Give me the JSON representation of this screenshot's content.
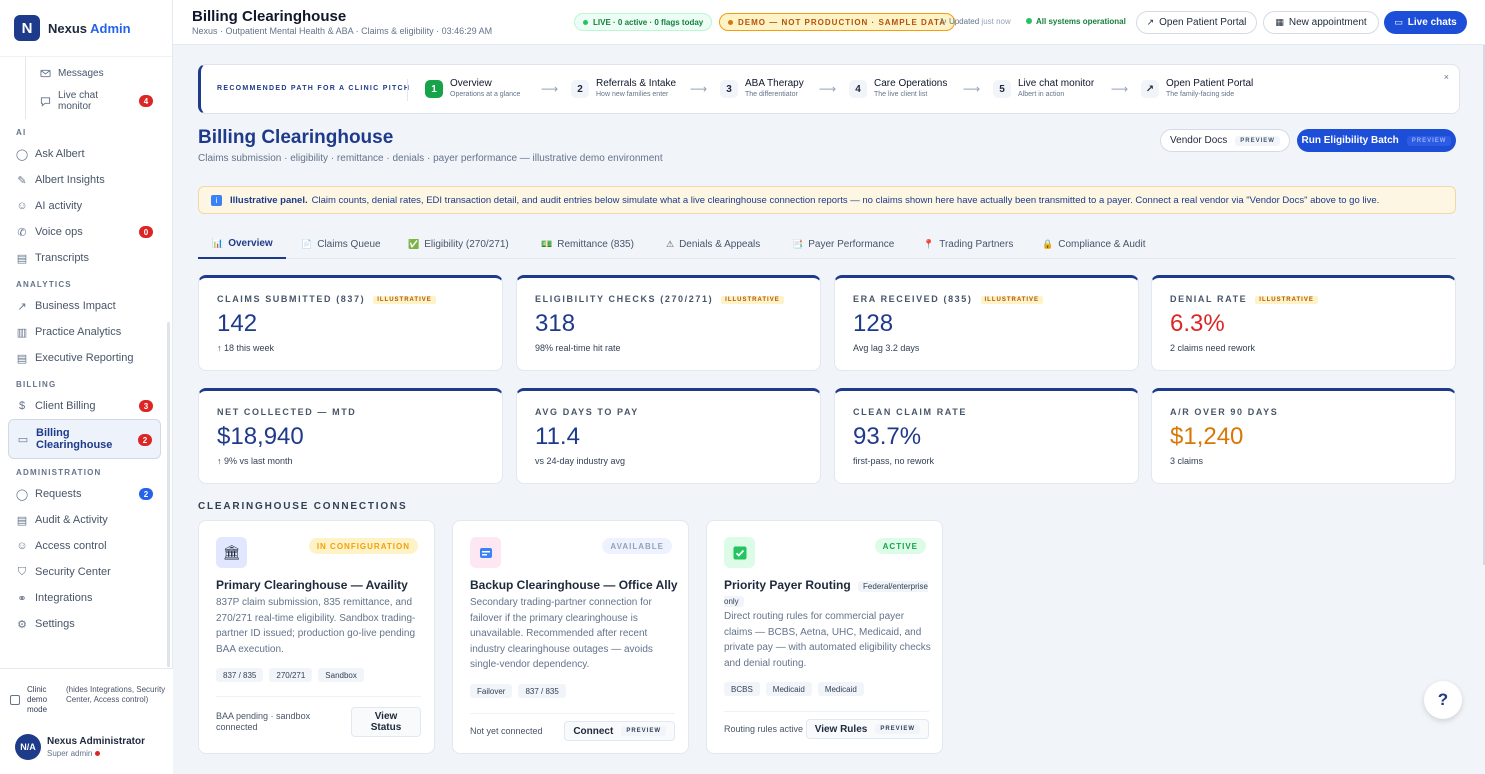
{
  "app": {
    "logo_letter": "N",
    "name": "Nexus",
    "name_suffix": "Admin"
  },
  "sidebar": {
    "sub_items": [
      {
        "label": "Messages",
        "icon": "mail-icon"
      },
      {
        "label": "Live chat monitor",
        "icon": "chat-icon",
        "badge": "4"
      }
    ],
    "sections": [
      {
        "label": "AI",
        "items": [
          {
            "label": "Ask Albert",
            "icon": "chat-bubble-icon"
          },
          {
            "label": "Albert Insights",
            "icon": "pen-icon"
          },
          {
            "label": "AI activity",
            "icon": "user-icon"
          },
          {
            "label": "Voice ops",
            "icon": "phone-icon",
            "badge": "0"
          },
          {
            "label": "Transcripts",
            "icon": "document-icon"
          }
        ]
      },
      {
        "label": "ANALYTICS",
        "items": [
          {
            "label": "Business Impact",
            "icon": "trend-icon"
          },
          {
            "label": "Practice Analytics",
            "icon": "bar-chart-icon"
          },
          {
            "label": "Executive Reporting",
            "icon": "document-icon"
          }
        ]
      },
      {
        "label": "BILLING",
        "items": [
          {
            "label": "Client Billing",
            "icon": "dollar-icon",
            "badge": "3"
          },
          {
            "label": "Billing Clearinghouse",
            "icon": "card-icon",
            "badge": "2",
            "active": true
          }
        ]
      },
      {
        "label": "ADMINISTRATION",
        "items": [
          {
            "label": "Requests",
            "icon": "chat-bubble-icon",
            "badge": "2"
          },
          {
            "label": "Audit & Activity",
            "icon": "document-icon"
          },
          {
            "label": "Access control",
            "icon": "user-icon"
          },
          {
            "label": "Security Center",
            "icon": "shield-icon"
          },
          {
            "label": "Integrations",
            "icon": "link-icon"
          },
          {
            "label": "Settings",
            "icon": "gear-icon"
          }
        ]
      }
    ],
    "demo_mode": {
      "label": "Clinic demo mode",
      "note": "(hides Integrations, Security Center, Access control)"
    },
    "user": {
      "initials": "N/A",
      "name": "Nexus Administrator",
      "role": "Super admin"
    }
  },
  "topbar": {
    "title": "Billing Clearinghouse",
    "breadcrumb": "Nexus · Outpatient Mental Health & ABA · Claims & eligibility · 03:46:29 AM",
    "live_pill": "LIVE · 0 active · 0 flags today",
    "demo_pill": "DEMO — NOT PRODUCTION · SAMPLE DATA",
    "updated": "Updated",
    "updated_when": "just now",
    "status": "All systems operational",
    "buttons": {
      "portal": "Open Patient Portal",
      "appointment": "New appointment",
      "chats": "Live chats"
    }
  },
  "path": {
    "label": "RECOMMENDED PATH FOR A CLINIC PITCH",
    "steps": [
      {
        "num": "1",
        "title": "Overview",
        "sub": "Operations at a glance"
      },
      {
        "num": "2",
        "title": "Referrals & Intake",
        "sub": "How new families enter"
      },
      {
        "num": "3",
        "title": "ABA Therapy",
        "sub": "The differentiator"
      },
      {
        "num": "4",
        "title": "Care Operations",
        "sub": "The live client list"
      },
      {
        "num": "5",
        "title": "Live chat monitor",
        "sub": "Albert in action"
      },
      {
        "num": "↗",
        "title": "Open Patient Portal",
        "sub": "The family-facing side"
      }
    ],
    "close": "×"
  },
  "page": {
    "title": "Billing Clearinghouse",
    "subtitle": "Claims submission · eligibility · remittance · denials · payer performance — illustrative demo environment",
    "vendor_docs": "Vendor Docs",
    "run_batch": "Run Eligibility Batch",
    "preview_tag": "PREVIEW"
  },
  "banner": {
    "bold": "Illustrative panel.",
    "text": "Claim counts, denial rates, EDI transaction detail, and audit entries below simulate what a live clearinghouse connection reports — no claims shown here have actually been transmitted to a payer. Connect a real vendor via \"Vendor Docs\" above to go live."
  },
  "tabs": [
    {
      "label": "Overview",
      "icon": "📊"
    },
    {
      "label": "Claims Queue",
      "icon": "📄"
    },
    {
      "label": "Eligibility (270/271)",
      "icon": "✅"
    },
    {
      "label": "Remittance (835)",
      "icon": "💵"
    },
    {
      "label": "Denials & Appeals",
      "icon": "⚠"
    },
    {
      "label": "Payer Performance",
      "icon": "📑"
    },
    {
      "label": "Trading Partners",
      "icon": "📍"
    },
    {
      "label": "Compliance & Audit",
      "icon": "🔒"
    }
  ],
  "kpis": [
    {
      "label": "CLAIMS SUBMITTED (837)",
      "tag": "ILLUSTRATIVE",
      "value": "142",
      "sub": "↑ 18 this week"
    },
    {
      "label": "ELIGIBILITY CHECKS (270/271)",
      "tag": "ILLUSTRATIVE",
      "value": "318",
      "sub": "98% real-time hit rate"
    },
    {
      "label": "ERA RECEIVED (835)",
      "tag": "ILLUSTRATIVE",
      "value": "128",
      "sub": "Avg lag 3.2 days"
    },
    {
      "label": "DENIAL RATE",
      "tag": "ILLUSTRATIVE",
      "value": "6.3%",
      "sub": "2 claims need rework"
    },
    {
      "label": "NET COLLECTED — MTD",
      "value": "$18,940",
      "sub": "↑ 9% vs last month"
    },
    {
      "label": "AVG DAYS TO PAY",
      "value": "11.4",
      "sub": "vs 24-day industry avg"
    },
    {
      "label": "CLEAN CLAIM RATE",
      "value": "93.7%",
      "sub": "first-pass, no rework"
    },
    {
      "label": "A/R OVER 90 DAYS",
      "value": "$1,240",
      "sub": "3 claims"
    }
  ],
  "connections": {
    "heading": "CLEARINGHOUSE CONNECTIONS",
    "cards": [
      {
        "status": "IN CONFIGURATION",
        "name": "Primary Clearinghouse — Availity",
        "desc": "837P claim submission, 835 remittance, and 270/271 real-time eligibility. Sandbox trading-partner ID issued; production go-live pending BAA execution.",
        "chips": [
          "837 / 835",
          "270/271",
          "Sandbox"
        ],
        "foot": "BAA pending · sandbox connected",
        "button": "View Status"
      },
      {
        "status": "AVAILABLE",
        "name": "Backup Clearinghouse — Office Ally",
        "desc": "Secondary trading-partner connection for failover if the primary clearinghouse is unavailable. Recommended after recent industry clearinghouse outages — avoids single-vendor dependency.",
        "chips": [
          "Failover",
          "837 / 835"
        ],
        "foot": "Not yet connected",
        "button": "Connect",
        "button_tag": "PREVIEW"
      },
      {
        "status": "ACTIVE",
        "name": "Priority Payer Routing",
        "name_tag": "Federal/enterprise only",
        "desc": "Direct routing rules for commercial payer claims — BCBS, Aetna, UHC, Medicaid, and private pay — with automated eligibility checks and denial routing.",
        "chips": [
          "BCBS",
          "Medicaid",
          "Medicaid"
        ],
        "foot": "Routing rules active",
        "button": "View Rules",
        "button_tag": "PREVIEW"
      }
    ]
  },
  "help": "?"
}
